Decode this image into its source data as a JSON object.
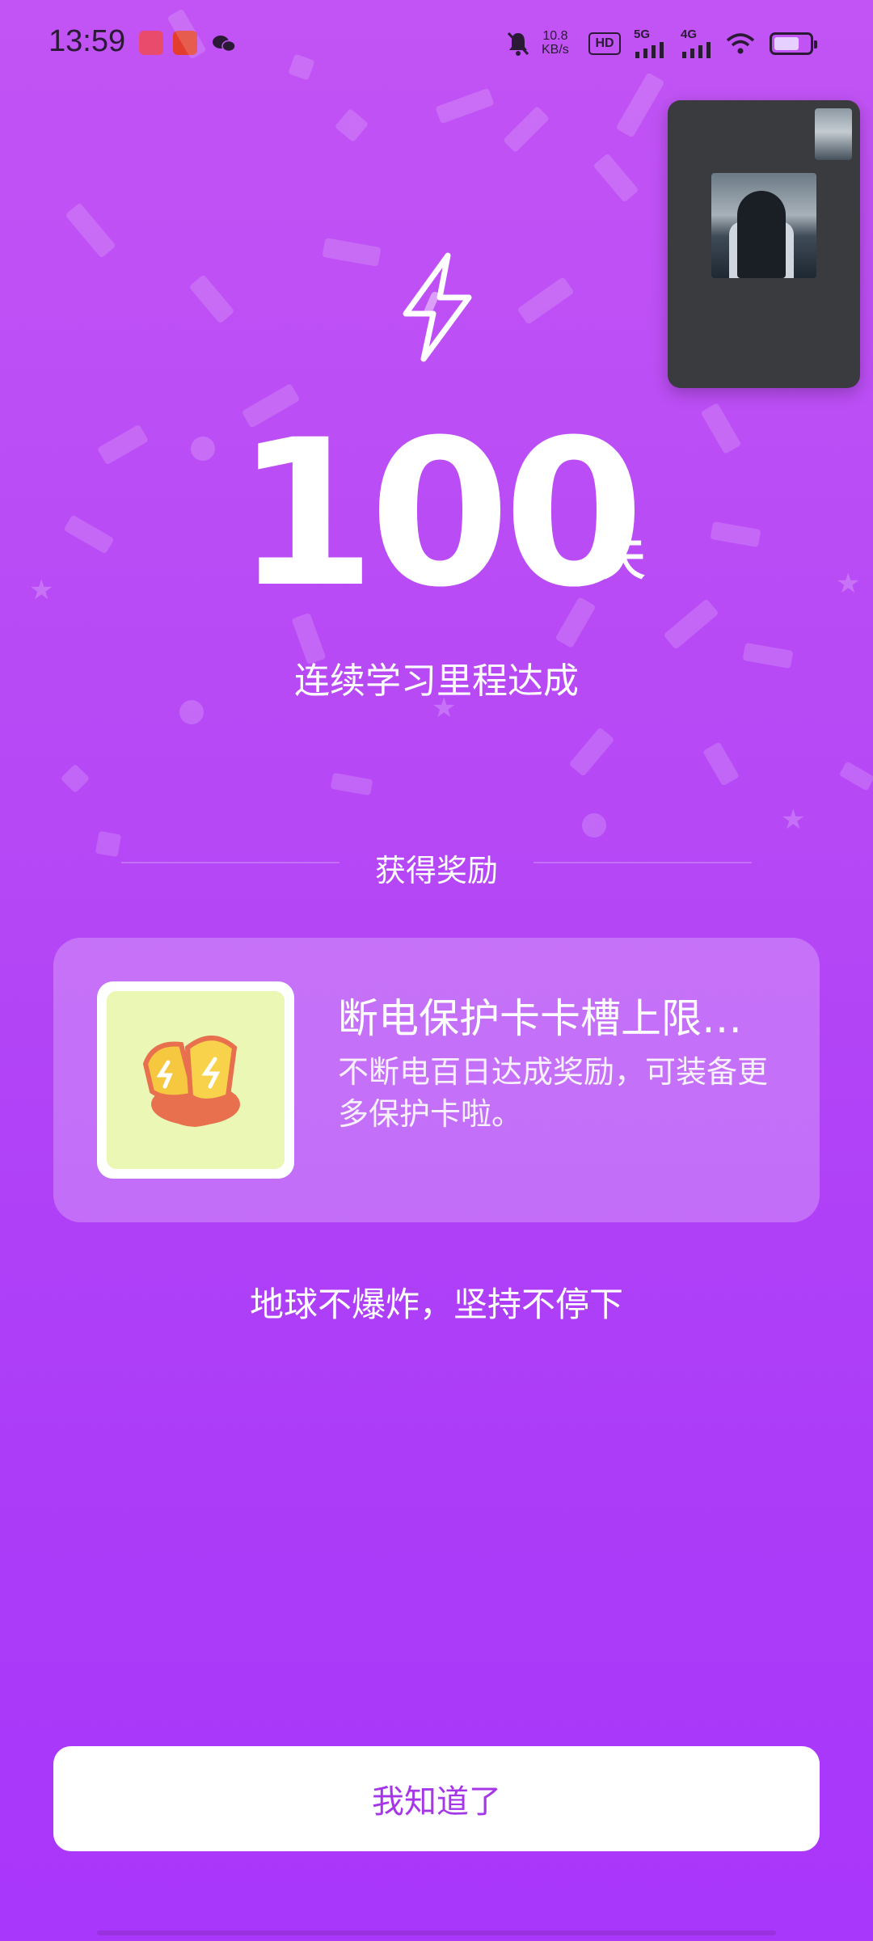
{
  "status_bar": {
    "time": "13:59",
    "speed_top": "10.8",
    "speed_bottom": "KB/s",
    "hd": "HD",
    "net_5g": "5G",
    "net_4g": "4G",
    "colors": {
      "text": "#2a1a35"
    }
  },
  "milestone": {
    "count": "100",
    "unit": "天",
    "subtitle": "连续学习里程达成"
  },
  "reward": {
    "section_label": "获得奖励",
    "title": "断电保护卡卡槽上限…",
    "description": "不断电百日达成奖励，可装备更多保护卡啦。"
  },
  "motto": "地球不爆炸，坚持不停下",
  "confirm_button": "我知道了",
  "icons": [
    "lightning-icon",
    "reward-card-icon",
    "mute-icon",
    "wifi-icon",
    "battery-icon"
  ],
  "colors": {
    "background_top": "#c254f5",
    "background_bottom": "#a936fb",
    "button_text": "#a537e8",
    "card_icon_bg": "#eaf7b5"
  }
}
